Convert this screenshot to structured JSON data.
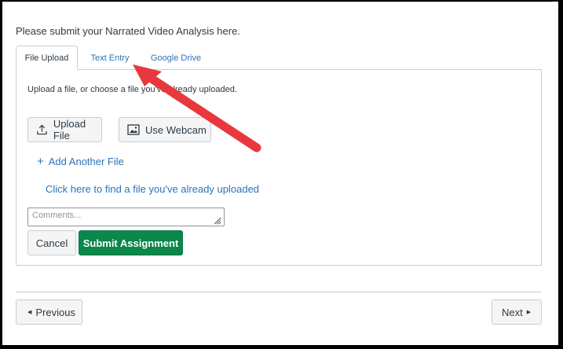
{
  "prompt": "Please submit your Narrated Video Analysis here.",
  "tabs": [
    {
      "label": "File Upload"
    },
    {
      "label": "Text Entry"
    },
    {
      "label": "Google Drive"
    }
  ],
  "upload": {
    "instructions": "Upload a file, or choose a file you've already uploaded.",
    "upload_file_label": "Upload File",
    "use_webcam_label": "Use Webcam",
    "add_another_label": "Add Another File",
    "find_file_link": "Click here to find a file you've already uploaded",
    "comments_placeholder": "Comments...",
    "cancel_label": "Cancel",
    "submit_label": "Submit Assignment"
  },
  "nav": {
    "previous_label": "Previous",
    "next_label": "Next"
  },
  "icons": {
    "upload": "upload-icon",
    "webcam": "image-icon",
    "plus": "plus-icon",
    "prev": "triangle-left-icon",
    "next": "triangle-right-icon"
  },
  "colors": {
    "link": "#2b73b9",
    "submit": "#0b874b",
    "annotation_arrow": "#e8383d"
  }
}
